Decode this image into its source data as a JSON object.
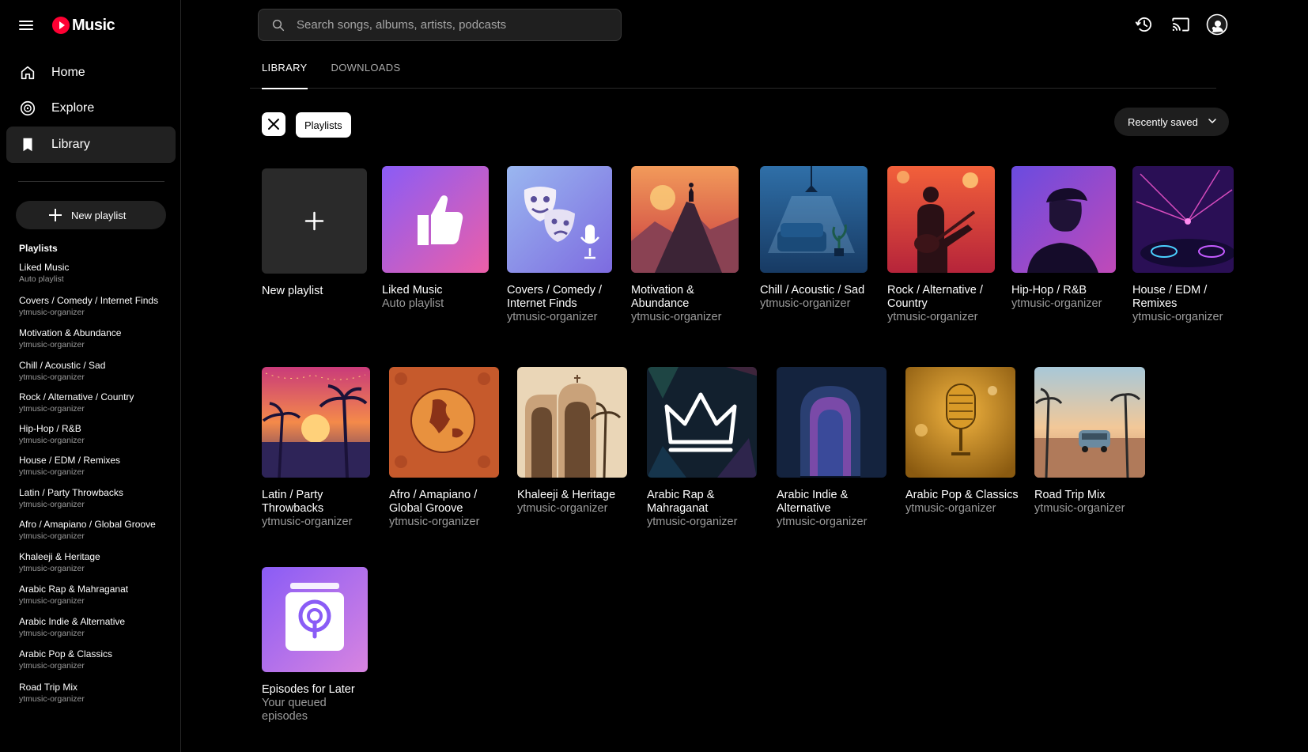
{
  "app": {
    "name": "Music"
  },
  "nav": [
    {
      "label": "Home",
      "icon": "home-icon"
    },
    {
      "label": "Explore",
      "icon": "explore-icon"
    },
    {
      "label": "Library",
      "icon": "library-icon",
      "active": true
    }
  ],
  "sidebar": {
    "new_playlist_label": "New playlist",
    "section_title": "Playlists",
    "items": [
      {
        "title": "Liked Music",
        "sub": "Auto playlist"
      },
      {
        "title": "Covers / Comedy / Internet Finds",
        "sub": "ytmusic-organizer"
      },
      {
        "title": "Motivation & Abundance",
        "sub": "ytmusic-organizer"
      },
      {
        "title": "Chill / Acoustic / Sad",
        "sub": "ytmusic-organizer"
      },
      {
        "title": "Rock / Alternative / Country",
        "sub": "ytmusic-organizer"
      },
      {
        "title": "Hip-Hop / R&B",
        "sub": "ytmusic-organizer"
      },
      {
        "title": "House / EDM / Remixes",
        "sub": "ytmusic-organizer"
      },
      {
        "title": "Latin / Party Throwbacks",
        "sub": "ytmusic-organizer"
      },
      {
        "title": "Afro / Amapiano / Global Groove",
        "sub": "ytmusic-organizer"
      },
      {
        "title": "Khaleeji & Heritage",
        "sub": "ytmusic-organizer"
      },
      {
        "title": "Arabic Rap & Mahraganat",
        "sub": "ytmusic-organizer"
      },
      {
        "title": "Arabic Indie & Alternative",
        "sub": "ytmusic-organizer"
      },
      {
        "title": "Arabic Pop & Classics",
        "sub": "ytmusic-organizer"
      },
      {
        "title": "Road Trip Mix",
        "sub": "ytmusic-organizer"
      }
    ]
  },
  "search": {
    "placeholder": "Search songs, albums, artists, podcasts"
  },
  "topbar": {
    "icons": [
      "history-icon",
      "cast-icon",
      "account-avatar-icon"
    ]
  },
  "tabs": [
    "LIBRARY",
    "DOWNLOADS"
  ],
  "filters": {
    "chip": "Playlists",
    "sort": "Recently saved"
  },
  "grid": {
    "new_playlist": {
      "title": "New playlist"
    },
    "cards": [
      {
        "title": "Liked Music",
        "sub": "Auto playlist",
        "art": "thumbs-up"
      },
      {
        "title": "Covers / Comedy / Internet Finds",
        "sub": "ytmusic-organizer",
        "art": "masks"
      },
      {
        "title": "Motivation & Abundance",
        "sub": "ytmusic-organizer",
        "art": "mountain"
      },
      {
        "title": "Chill / Acoustic / Sad",
        "sub": "ytmusic-organizer",
        "art": "couch"
      },
      {
        "title": "Rock / Alternative / Country",
        "sub": "ytmusic-organizer",
        "art": "guitarist"
      },
      {
        "title": "Hip-Hop / R&B",
        "sub": "ytmusic-organizer",
        "art": "rapper"
      },
      {
        "title": "House / EDM / Remixes",
        "sub": "ytmusic-organizer",
        "art": "dj"
      },
      {
        "title": "Latin / Party Throwbacks",
        "sub": "ytmusic-organizer",
        "art": "palms-sunset"
      },
      {
        "title": "Afro / Amapiano / Global Groove",
        "sub": "ytmusic-organizer",
        "art": "globe"
      },
      {
        "title": "Khaleeji & Heritage",
        "sub": "ytmusic-organizer",
        "art": "arches"
      },
      {
        "title": "Arabic Rap & Mahraganat",
        "sub": "ytmusic-organizer",
        "art": "crown"
      },
      {
        "title": "Arabic Indie & Alternative",
        "sub": "ytmusic-organizer",
        "art": "doorway"
      },
      {
        "title": "Arabic Pop & Classics",
        "sub": "ytmusic-organizer",
        "art": "microphone"
      },
      {
        "title": "Road Trip Mix",
        "sub": "ytmusic-organizer",
        "art": "van"
      },
      {
        "title": "Episodes for Later",
        "sub": "Your queued episodes",
        "art": "podcast"
      }
    ]
  }
}
